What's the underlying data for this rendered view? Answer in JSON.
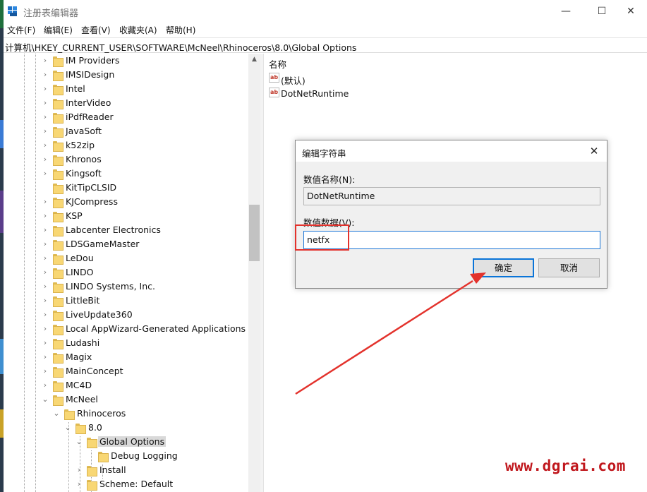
{
  "window": {
    "title": "注册表编辑器",
    "minimize_glyph": "—",
    "maximize_glyph": "☐",
    "close_glyph": "✕"
  },
  "menu": [
    "文件(F)",
    "编辑(E)",
    "查看(V)",
    "收藏夹(A)",
    "帮助(H)"
  ],
  "address": "计算机\\HKEY_CURRENT_USER\\SOFTWARE\\McNeel\\Rhinoceros\\8.0\\Global Options",
  "tree": {
    "items": [
      {
        "label": "IM Providers",
        "expander": "›"
      },
      {
        "label": "IMSIDesign",
        "expander": "›"
      },
      {
        "label": "Intel",
        "expander": "›"
      },
      {
        "label": "InterVideo",
        "expander": "›"
      },
      {
        "label": "iPdfReader",
        "expander": "›"
      },
      {
        "label": "JavaSoft",
        "expander": "›"
      },
      {
        "label": "k52zip",
        "expander": "›"
      },
      {
        "label": "Khronos",
        "expander": "›"
      },
      {
        "label": "Kingsoft",
        "expander": "›"
      },
      {
        "label": "KitTipCLSID",
        "expander": ""
      },
      {
        "label": "KJCompress",
        "expander": "›"
      },
      {
        "label": "KSP",
        "expander": "›"
      },
      {
        "label": "Labcenter Electronics",
        "expander": "›"
      },
      {
        "label": "LDSGameMaster",
        "expander": "›"
      },
      {
        "label": "LeDou",
        "expander": "›"
      },
      {
        "label": "LINDO",
        "expander": "›"
      },
      {
        "label": "LINDO Systems, Inc.",
        "expander": "›"
      },
      {
        "label": "LittleBit",
        "expander": "›"
      },
      {
        "label": "LiveUpdate360",
        "expander": "›"
      },
      {
        "label": "Local AppWizard-Generated Applications",
        "expander": "›"
      },
      {
        "label": "Ludashi",
        "expander": "›"
      },
      {
        "label": "Magix",
        "expander": "›"
      },
      {
        "label": "MainConcept",
        "expander": "›"
      },
      {
        "label": "MC4D",
        "expander": "›"
      },
      {
        "label": "McNeel",
        "expander": "⌄"
      },
      {
        "label": "Rhinoceros",
        "expander": "⌄"
      },
      {
        "label": "8.0",
        "expander": "⌄"
      },
      {
        "label": "Global Options",
        "expander": "⌄"
      },
      {
        "label": "Debug Logging",
        "expander": ""
      },
      {
        "label": "Install",
        "expander": "›"
      },
      {
        "label": "Scheme: Default",
        "expander": "›"
      }
    ],
    "scroll_up_glyph": "▲"
  },
  "list": {
    "column_name": "名称",
    "type_icon_text": "ab",
    "values": [
      {
        "name": "(默认)"
      },
      {
        "name": "DotNetRuntime"
      }
    ]
  },
  "dialog": {
    "title": "编辑字符串",
    "close_glyph": "✕",
    "name_label": "数值名称(N):",
    "name_value": "DotNetRuntime",
    "data_label": "数值数据(V):",
    "data_value": "netfx",
    "ok_label": "确定",
    "cancel_label": "取消"
  },
  "watermark": "www.dgrai.com",
  "colors": {
    "annotation_red": "#e3322c",
    "folder_yellow": "#f8d774",
    "accent_blue": "#0a74d8"
  }
}
